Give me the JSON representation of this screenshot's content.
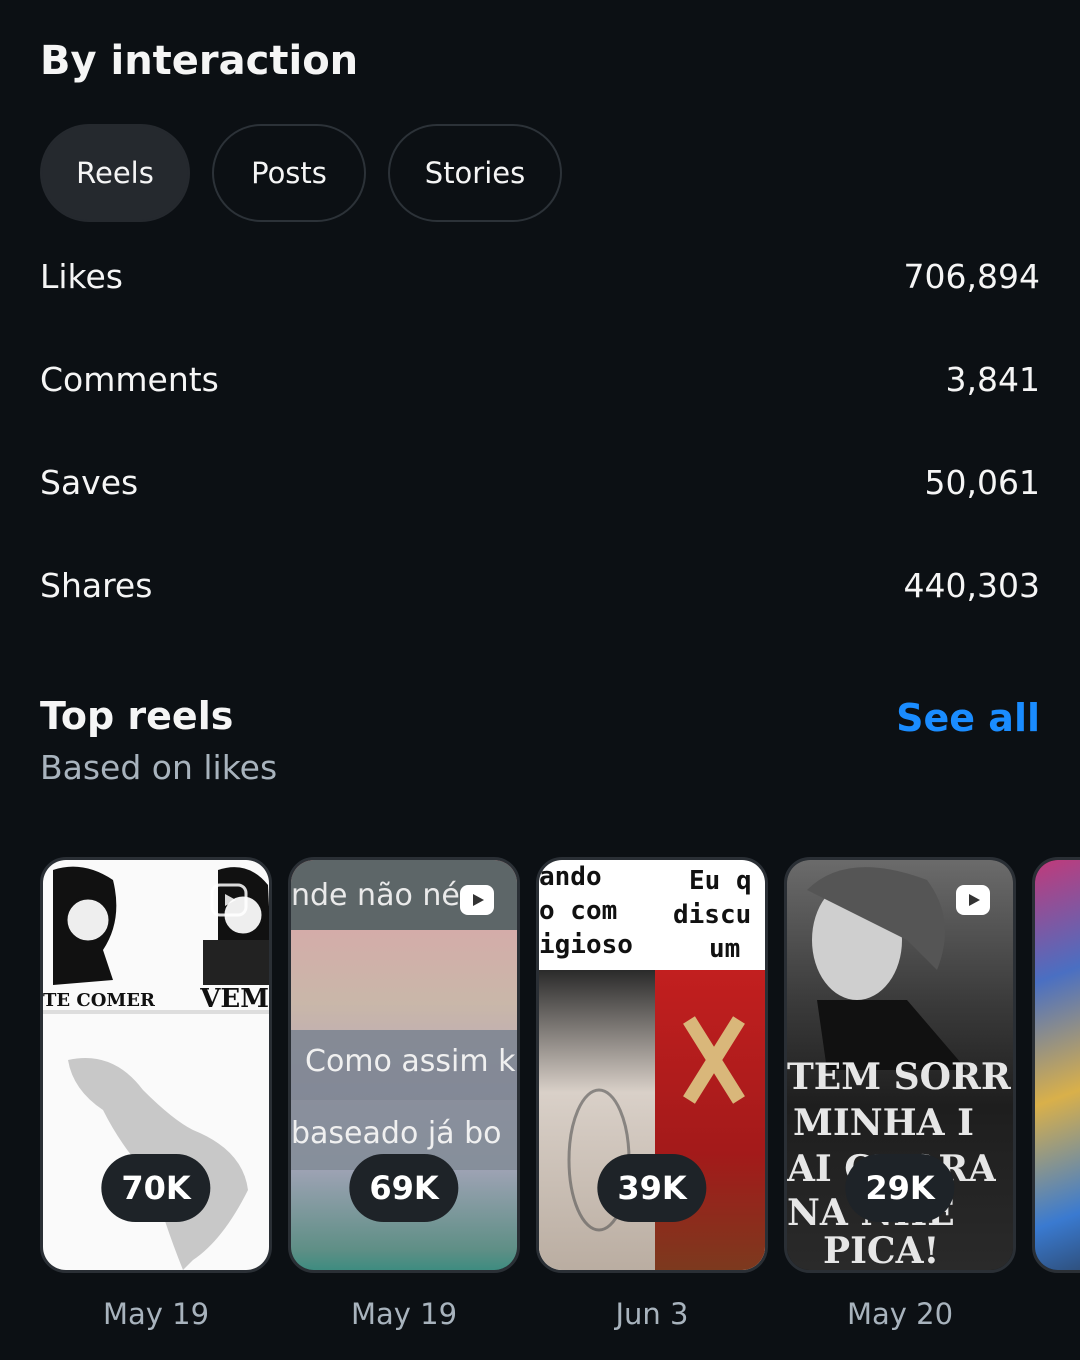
{
  "interaction": {
    "title": "By interaction",
    "tabs": [
      {
        "label": "Reels",
        "active": true
      },
      {
        "label": "Posts",
        "active": false
      },
      {
        "label": "Stories",
        "active": false
      }
    ],
    "metrics": [
      {
        "label": "Likes",
        "value": "706,894"
      },
      {
        "label": "Comments",
        "value": "3,841"
      },
      {
        "label": "Saves",
        "value": "50,061"
      },
      {
        "label": "Shares",
        "value": "440,303"
      }
    ]
  },
  "top_reels": {
    "title": "Top reels",
    "subtitle": "Based on likes",
    "see_all": "See all",
    "items": [
      {
        "count": "70K",
        "date": "May 19",
        "thumb_text": [
          "TE COMER",
          "VEM"
        ]
      },
      {
        "count": "69K",
        "date": "May 19",
        "thumb_text": [
          "nde não né",
          "Como assim k",
          "baseado já bo"
        ]
      },
      {
        "count": "39K",
        "date": "Jun 3",
        "thumb_text": [
          "ando",
          "o com",
          "igioso",
          "Eu q",
          "discu",
          "um"
        ]
      },
      {
        "count": "29K",
        "date": "May 20",
        "thumb_text": [
          "TEM SORR",
          "MINHA I",
          "AI CHORA",
          "NA NHE",
          "PICA!"
        ]
      }
    ]
  },
  "colors": {
    "background": "#0c1014",
    "link": "#1a8cff",
    "secondary_text": "#a8b3bd",
    "pill": "#1e2328"
  }
}
